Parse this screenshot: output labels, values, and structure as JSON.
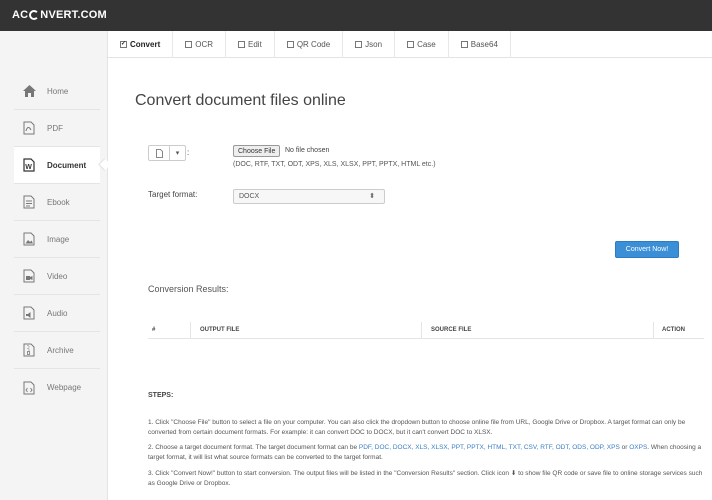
{
  "app": {
    "logo_left": "AC",
    "logo_right": "NVERT.COM"
  },
  "tabs": [
    {
      "label": "Convert",
      "checked": true
    },
    {
      "label": "OCR",
      "checked": false
    },
    {
      "label": "Edit",
      "checked": false
    },
    {
      "label": "QR Code",
      "checked": false
    },
    {
      "label": "Json",
      "checked": false
    },
    {
      "label": "Case",
      "checked": false
    },
    {
      "label": "Base64",
      "checked": false
    }
  ],
  "sidebar": {
    "items": [
      {
        "label": "Home",
        "icon": "home-icon"
      },
      {
        "label": "PDF",
        "icon": "pdf-icon"
      },
      {
        "label": "Document",
        "icon": "word-icon",
        "active": true
      },
      {
        "label": "Ebook",
        "icon": "ebook-icon"
      },
      {
        "label": "Image",
        "icon": "image-icon"
      },
      {
        "label": "Video",
        "icon": "video-icon"
      },
      {
        "label": "Audio",
        "icon": "audio-icon"
      },
      {
        "label": "Archive",
        "icon": "archive-icon"
      },
      {
        "label": "Webpage",
        "icon": "webpage-icon"
      }
    ]
  },
  "main": {
    "title": "Convert document files online",
    "source_colon": ":",
    "choose_file_label": "Choose File",
    "no_file_text": "No file chosen",
    "formats_hint": "(DOC, RTF, TXT, ODT, XPS, XLS, XLSX, PPT, PPTX, HTML etc.)",
    "target_label": "Target format:",
    "target_value": "DOCX",
    "convert_button": "Convert Now!",
    "results_title": "Conversion Results:",
    "results_columns": {
      "num": "#",
      "output": "OUTPUT FILE",
      "source": "SOURCE FILE",
      "action": "ACTION"
    }
  },
  "steps": {
    "title": "STEPS:",
    "step1": "1. Click \"Choose File\" button to select a file on your computer. You can also click the dropdown button to choose online file from URL, Google Drive or Dropbox. A target format can only be converted from certain document formats. For example: it can convert DOC to DOCX, but it can't convert DOC to XLSX.",
    "step2_a": "2. Choose a target document format. The target document format can be ",
    "step2_formats": "PDF, DOC, DOCX, XLS, XLSX, PPT, PPTX, HTML, TXT, CSV, RTF, ODT, ODS, ODP, XPS",
    "step2_or": " or ",
    "step2_last": "OXPS",
    "step2_b": ". When choosing a target format, it will list what source formats can be converted to the target format.",
    "step3_a": "3. Click \"Convert Now!\" button to start conversion. The output files will be listed in the \"Conversion Results\" section. Click icon ",
    "step3_icon": "⬇",
    "step3_b": " to show file QR code or save file to online storage services such as Google Drive or Dropbox."
  }
}
